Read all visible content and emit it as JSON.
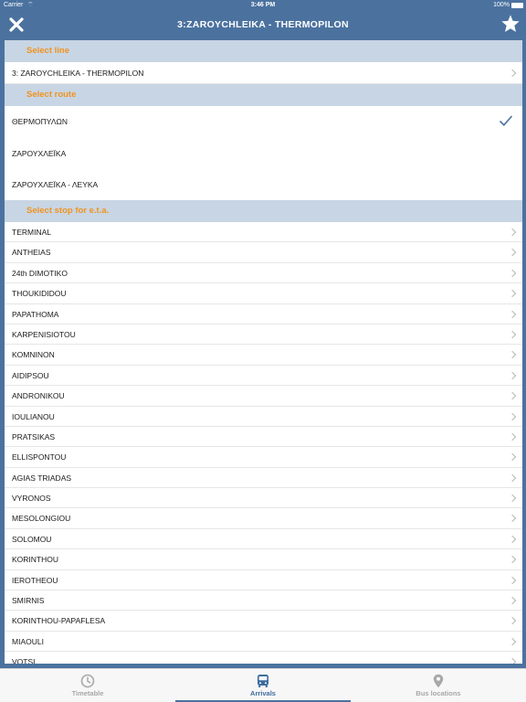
{
  "status": {
    "carrier": "Carrier",
    "time": "3:46 PM",
    "battery": "100%"
  },
  "nav": {
    "title": "3:ZAROYCHLEIKA - THERMOPILON",
    "left_icon": "close-icon",
    "right_icon": "star-icon"
  },
  "sections": {
    "line_header": "Select line",
    "line_value": "3: ZAROYCHLEIKA - THERMOPILON",
    "route_header": "Select route",
    "stop_header": "Select stop for e.t.a."
  },
  "routes": [
    {
      "label": "ΘΕΡΜΟΠΥΛΩΝ",
      "selected": true
    },
    {
      "label": "ΖΑΡΟΥΧΛΕΪΚΑ",
      "selected": false
    },
    {
      "label": "ΖΑΡΟΥΧΛΕΪΚΑ - ΛΕΥΚΑ",
      "selected": false
    }
  ],
  "stops": [
    "TERMINAL",
    "ANTHEIAS",
    "24th DIMOTIKO",
    "THOUKIDIDOU",
    "PAPATHOMA",
    "KARPENISIOTOU",
    "KOMNINON",
    "AIDIPSOU",
    "ANDRONIKOU",
    "IOULIANOU",
    "PRATSIKAS",
    "ELLISPONTOU",
    "AGIAS TRIADAS",
    "VYRONOS",
    "MESOLONGIOU",
    "SOLOMOU",
    "KORINTHOU",
    "IEROTHEOU",
    "SMIRNIS",
    "KORINTHOU-PAPAFLESA",
    "MIAOULI",
    "VOTSI"
  ],
  "tabs": [
    {
      "label": "Timetable",
      "icon": "clock-icon",
      "active": false
    },
    {
      "label": "Arrivals",
      "icon": "bus-icon",
      "active": true
    },
    {
      "label": "Bus locations",
      "icon": "location-pin-icon",
      "active": false
    }
  ],
  "colors": {
    "bar": "#4b729f",
    "section_bg": "#c8d5e4",
    "section_text": "#f0941e",
    "active_tab": "#3f6d9d"
  }
}
